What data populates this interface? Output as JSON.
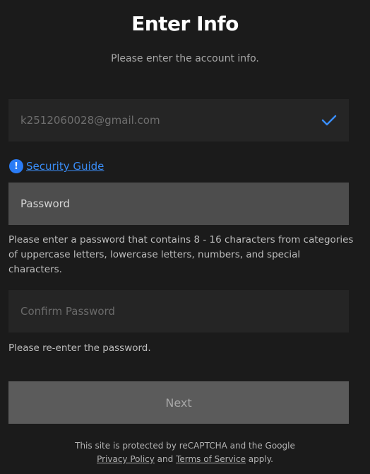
{
  "header": {
    "title": "Enter Info",
    "subtitle": "Please enter the account info."
  },
  "email_field": {
    "value": "k2512060028@gmail.com",
    "status_icon": "checkmark-icon",
    "status_color": "#3a8df7"
  },
  "security_guide": {
    "icon": "info-icon",
    "icon_glyph": "!",
    "label": "Security Guide"
  },
  "password_field": {
    "placeholder": "Password",
    "hint": "Please enter a password that contains 8 - 16 characters from categories of uppercase letters, lowercase letters, numbers, and special characters."
  },
  "confirm_field": {
    "placeholder": "Confirm Password",
    "hint": "Please re-enter the password."
  },
  "next_button": {
    "label": "Next"
  },
  "footer": {
    "line1": "This site is protected by reCAPTCHA and the Google",
    "privacy_label": "Privacy Policy",
    "and_text": " and ",
    "terms_label": "Terms of Service",
    "apply_text": " apply."
  },
  "colors": {
    "background": "#1b1b1b",
    "accent": "#2a7cf6",
    "link": "#3a8df7"
  }
}
